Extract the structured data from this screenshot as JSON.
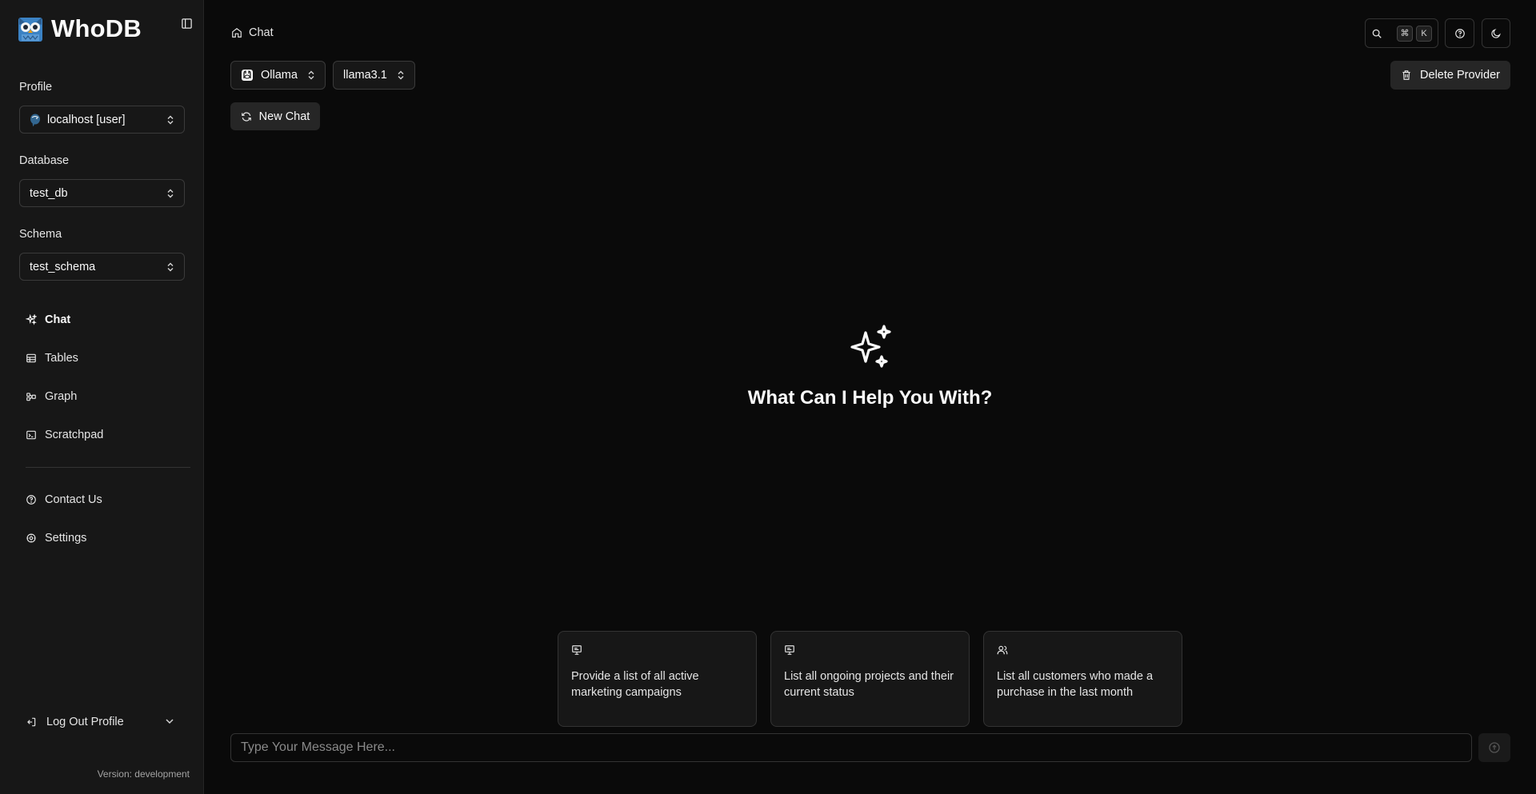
{
  "app": {
    "name": "WhoDB",
    "logo_icon": "owl-logo-icon"
  },
  "sidebar": {
    "profile": {
      "label": "Profile",
      "value": "localhost [user]",
      "icon": "postgres-elephant-icon"
    },
    "database": {
      "label": "Database",
      "value": "test_db"
    },
    "schema": {
      "label": "Schema",
      "value": "test_schema"
    },
    "nav": [
      {
        "label": "Chat",
        "icon": "sparkles-icon",
        "active": true
      },
      {
        "label": "Tables",
        "icon": "table-icon",
        "active": false
      },
      {
        "label": "Graph",
        "icon": "graph-icon",
        "active": false
      },
      {
        "label": "Scratchpad",
        "icon": "terminal-icon",
        "active": false
      }
    ],
    "secondary_nav": [
      {
        "label": "Contact Us",
        "icon": "help-circle-icon"
      },
      {
        "label": "Settings",
        "icon": "settings-icon"
      }
    ],
    "logout_label": "Log Out Profile",
    "version": "Version: development"
  },
  "header": {
    "breadcrumb": "Chat",
    "search_shortcut": [
      "⌘",
      "K"
    ]
  },
  "toolbar": {
    "provider": "Ollama",
    "model": "llama3.1",
    "delete_provider_label": "Delete Provider",
    "new_chat_label": "New Chat"
  },
  "hero": {
    "title": "What Can I Help You With?"
  },
  "suggestions": [
    {
      "text": "Provide a list of all active marketing campaigns",
      "icon": "presentation-icon"
    },
    {
      "text": "List all ongoing projects and their current status",
      "icon": "presentation-icon"
    },
    {
      "text": "List all customers who made a purchase in the last month",
      "icon": "users-icon"
    }
  ],
  "composer": {
    "placeholder": "Type Your Message Here..."
  },
  "colors": {
    "background": "#0a0a0a",
    "sidebar": "#171717",
    "border": "#333333",
    "text": "#fafafa"
  }
}
